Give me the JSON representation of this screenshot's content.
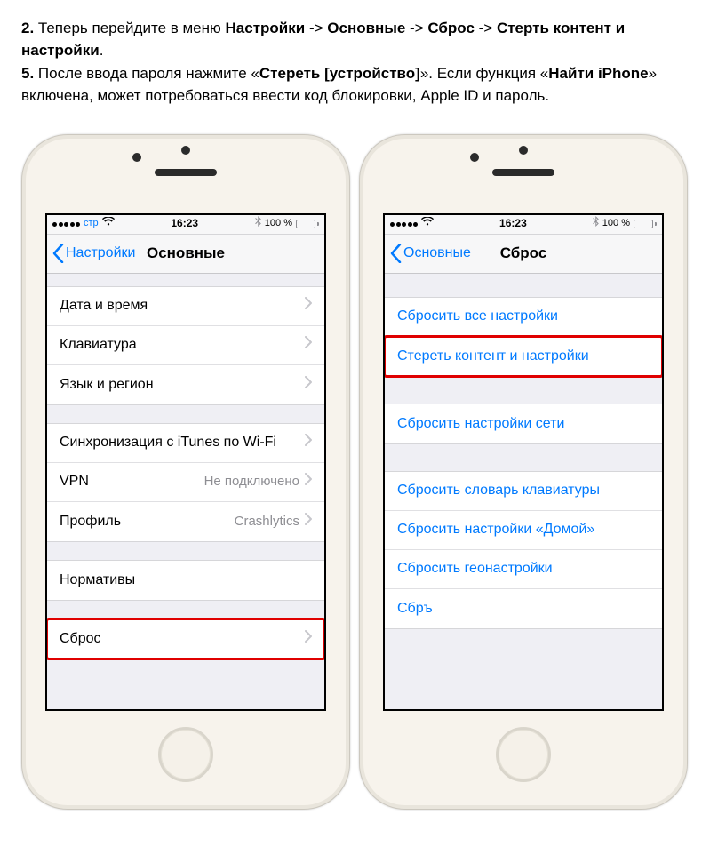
{
  "instructions": {
    "line1_num": "2.",
    "line1_a": " Теперь перейдите в меню ",
    "line1_b1": "Настройки",
    "line1_arrow": " -> ",
    "line1_b2": "Основные",
    "line1_b3": "Сброс",
    "line1_b4": "Стерть контент и настройки",
    "line1_end": ".",
    "line2_num": "5.",
    "line2_a": " После ввода пароля нажмите «",
    "line2_b1": "Стереть [устройство]",
    "line2_mid": "». Если функция «",
    "line2_b2": "Найти iPhone",
    "line2_end": "» включена, может потребоваться ввести код блокировки, Apple ID и пароль."
  },
  "status": {
    "carrier": "стр",
    "time": "16:23",
    "battery_text": "100 %",
    "battery_fill": "100%",
    "bt": "✱"
  },
  "phone1": {
    "nav_back": "Настройки",
    "nav_title": "Основные",
    "group1": [
      {
        "label": "Дата и время"
      },
      {
        "label": "Клавиатура"
      },
      {
        "label": "Язык и регион"
      }
    ],
    "group2": [
      {
        "label": "Синхронизация с iTunes по Wi-Fi"
      },
      {
        "label": "VPN",
        "value": "Не подключено"
      },
      {
        "label": "Профиль",
        "value": "Crashlytics"
      }
    ],
    "group3": [
      {
        "label": "Нормативы"
      }
    ],
    "group4": [
      {
        "label": "Сброс",
        "highlight": true
      }
    ]
  },
  "phone2": {
    "nav_back": "Основные",
    "nav_title": "Сброс",
    "group1": [
      {
        "label": "Сбросить все настройки"
      },
      {
        "label": "Стереть контент и настройки",
        "highlight": true
      }
    ],
    "group2": [
      {
        "label": "Сбросить настройки сети"
      }
    ],
    "group3": [
      {
        "label": "Сбросить словарь клавиатуры"
      },
      {
        "label": "Сбросить настройки «Домой»"
      },
      {
        "label": "Сбросить геонастройки"
      },
      {
        "label": "Сбръ"
      }
    ]
  }
}
